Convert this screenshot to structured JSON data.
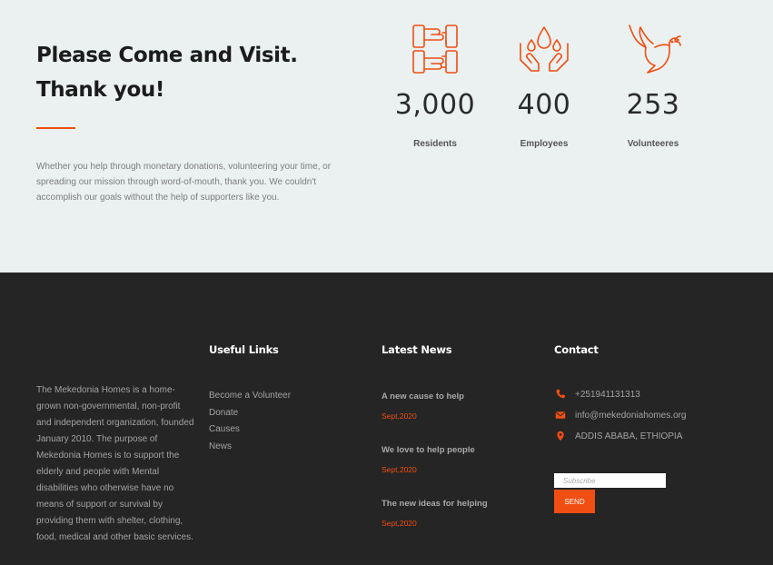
{
  "intro_section": {
    "headline": "Please Come and Visit. Thank you!",
    "description": "Whether you help through monetary donations, volunteering your time, or spreading our mission through word-of-mouth, thank you. We couldn't accomplish our goals without the help of supporters like you.",
    "accent_color": "#f04e12",
    "background": "#ebf0f0"
  },
  "stats": [
    {
      "icon": "hands-together-icon",
      "number": "3,000",
      "label": "Residents"
    },
    {
      "icon": "caring-hands-icon",
      "number": "400",
      "label": "Employees"
    },
    {
      "icon": "dove-icon",
      "number": "253",
      "label": "Volunteeres"
    }
  ],
  "footer": {
    "background": "#252525",
    "about": "The Mekedonia Homes is a home-grown non-governmental, non-profit and independent organization, founded January 2010. The purpose of Mekedonia Homes is to support the elderly and people with Mental disabilities who otherwise have no means of support or survival by providing them with shelter, clothing, food, medical and other basic services.",
    "useful_links": {
      "title": "Useful Links",
      "items": [
        "Become a Volunteer",
        "Donate",
        "Causes",
        "News"
      ]
    },
    "latest_news": {
      "title": "Latest News",
      "items": [
        {
          "title": "A new cause to help",
          "date": "Sept,2020"
        },
        {
          "title": "We love to help people",
          "date": "Sept,2020"
        },
        {
          "title": "The new ideas for helping",
          "date": "Sept,2020"
        }
      ]
    },
    "contact": {
      "title": "Contact",
      "phone": "+251941131313",
      "email": "info@mekedoniahomes.org",
      "address": "ADDIS ABABA, ETHIOPIA",
      "phone_icon": "phone-icon",
      "email_icon": "envelope-icon",
      "address_icon": "map-pin-icon"
    },
    "newsletter": {
      "placeholder": "Subscribe",
      "button": "SEND"
    }
  }
}
